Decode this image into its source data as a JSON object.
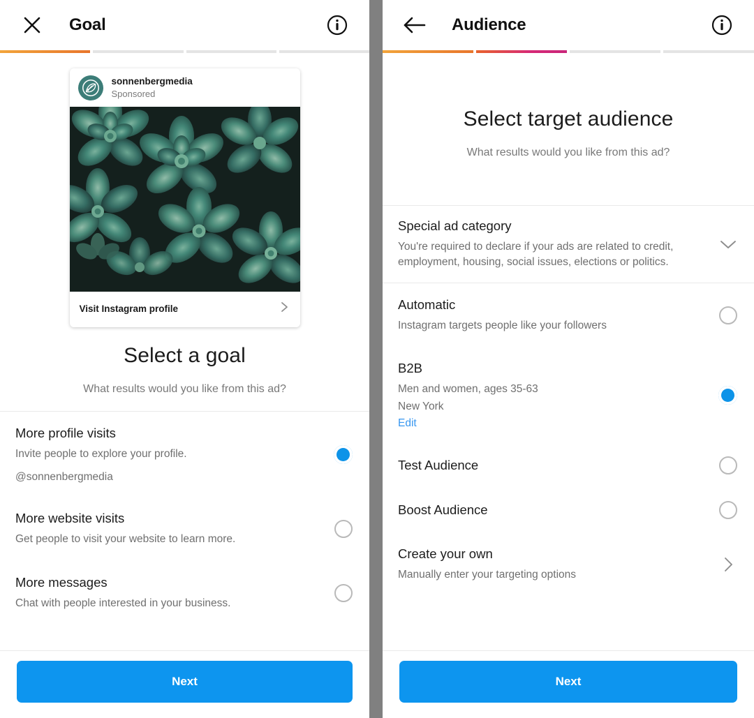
{
  "goal_screen": {
    "header": {
      "close_icon": "close-icon",
      "title": "Goal",
      "info_icon": "info-icon"
    },
    "progress": {
      "total_steps": 4,
      "completed_steps": 1
    },
    "ad_preview": {
      "account_name": "sonnenbergmedia",
      "sponsored_label": "Sponsored",
      "avatar_icon": "leaf-logo-icon",
      "image_alt": "green succulent plants top view",
      "cta_label": "Visit Instagram profile",
      "cta_chevron_icon": "chevron-right-icon"
    },
    "heading": {
      "title": "Select a goal",
      "subtitle": "What results would you like from this ad?"
    },
    "options": [
      {
        "title": "More profile visits",
        "description": "Invite people to explore your profile.",
        "extra": "@sonnenbergmedia",
        "selected": true
      },
      {
        "title": "More website visits",
        "description": "Get people to visit your website to learn more.",
        "selected": false
      },
      {
        "title": "More messages",
        "description": "Chat with people interested in your business.",
        "selected": false
      }
    ],
    "next_label": "Next"
  },
  "audience_screen": {
    "header": {
      "back_icon": "arrow-left-icon",
      "title": "Audience",
      "info_icon": "info-icon"
    },
    "progress": {
      "total_steps": 4,
      "completed_steps": 2
    },
    "heading": {
      "title": "Select target audience",
      "subtitle": "What results would you like from this ad?"
    },
    "special_category": {
      "title": "Special ad category",
      "description": "You're required to declare if your ads are related to credit, employment, housing, social issues, elections or politics.",
      "chevron_icon": "chevron-down-icon"
    },
    "options": [
      {
        "title": "Automatic",
        "description": "Instagram targets people like your followers",
        "selected": false
      },
      {
        "title": "B2B",
        "description": "Men and women, ages 35-63",
        "location": "New York",
        "edit_label": "Edit",
        "selected": true
      },
      {
        "title": "Test Audience",
        "description": "",
        "selected": false
      },
      {
        "title": "Boost Audience",
        "description": "",
        "selected": false
      }
    ],
    "create_own": {
      "title": "Create your own",
      "description": "Manually enter your targeting options",
      "chevron_icon": "chevron-right-icon"
    },
    "next_label": "Next"
  },
  "colors": {
    "accent_blue": "#0d95ef",
    "link_blue": "#3897f0",
    "progress_amber": "#f2a43a",
    "progress_magenta": "#d62976",
    "divider": "#e9e9e9",
    "avatar_teal": "#3c7d78"
  }
}
